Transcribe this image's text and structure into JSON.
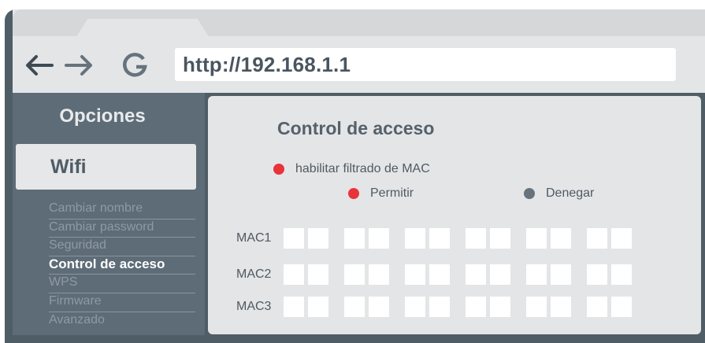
{
  "browser": {
    "url": "http://192.168.1.1",
    "back_icon": "arrow-left-icon",
    "forward_icon": "arrow-right-icon",
    "reload_icon": "reload-icon"
  },
  "sidebar": {
    "title": "Opciones",
    "section": "Wifi",
    "items": [
      {
        "label": "Cambiar nombre",
        "active": false
      },
      {
        "label": "Cambiar password",
        "active": false
      },
      {
        "label": "Seguridad",
        "active": false
      },
      {
        "label": "Control de acceso",
        "active": true
      },
      {
        "label": "WPS",
        "active": false
      },
      {
        "label": "Firmware",
        "active": false
      },
      {
        "label": "Avanzado",
        "active": false
      }
    ]
  },
  "main": {
    "title": "Control de acceso",
    "mac_filter": {
      "label": "habilitar filtrado de MAC",
      "color": "#e8333b"
    },
    "mode_options": [
      {
        "label": "Permitir",
        "selected": true,
        "color": "#e8333b"
      },
      {
        "label": "Denegar",
        "selected": false,
        "color": "#66737d"
      }
    ],
    "mac_rows": [
      {
        "label": "MAC1",
        "fields": [
          "",
          "",
          "",
          "",
          "",
          "",
          "",
          "",
          "",
          "",
          "",
          ""
        ]
      },
      {
        "label": "MAC2",
        "fields": [
          "",
          "",
          "",
          "",
          "",
          "",
          "",
          "",
          "",
          "",
          "",
          ""
        ]
      },
      {
        "label": "MAC3",
        "fields": [
          "",
          "",
          "",
          "",
          "",
          "",
          "",
          "",
          "",
          "",
          "",
          ""
        ]
      }
    ]
  },
  "colors": {
    "frame": "#4f5d66",
    "sidebar": "#5d6c77",
    "panel": "#e4e5e7",
    "accent_red": "#e8333b"
  }
}
